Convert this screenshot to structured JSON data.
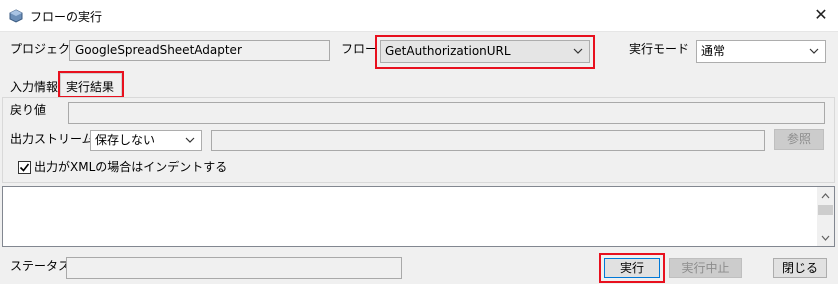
{
  "window": {
    "title": "フローの実行",
    "close_glyph": "✕"
  },
  "header": {
    "project_label": "プロジェクト",
    "project_value": "GoogleSpreadSheetAdapter",
    "flow_label": "フロー",
    "flow_value": "GetAuthorizationURL",
    "mode_label": "実行モード",
    "mode_value": "通常"
  },
  "tabs": [
    {
      "label": "入力情報",
      "selected": false
    },
    {
      "label": "実行結果",
      "selected": true
    }
  ],
  "result": {
    "return_label": "戻り値",
    "return_value": "",
    "stream_label": "出力ストリーム",
    "stream_option": "保存しない",
    "stream_path": "",
    "browse_label": "参照",
    "indent_checked": true,
    "indent_label": "出力がXMLの場合はインデントする",
    "output_text": ""
  },
  "footer": {
    "status_label": "ステータス",
    "status_value": "",
    "run_label": "実行",
    "abort_label": "実行中止",
    "close_label": "閉じる"
  },
  "highlight_color": "#e8101e",
  "icons": [
    "app-icon",
    "close-icon",
    "chevron-down-icon",
    "checkmark-icon",
    "scroll-up-icon",
    "scroll-down-icon"
  ]
}
